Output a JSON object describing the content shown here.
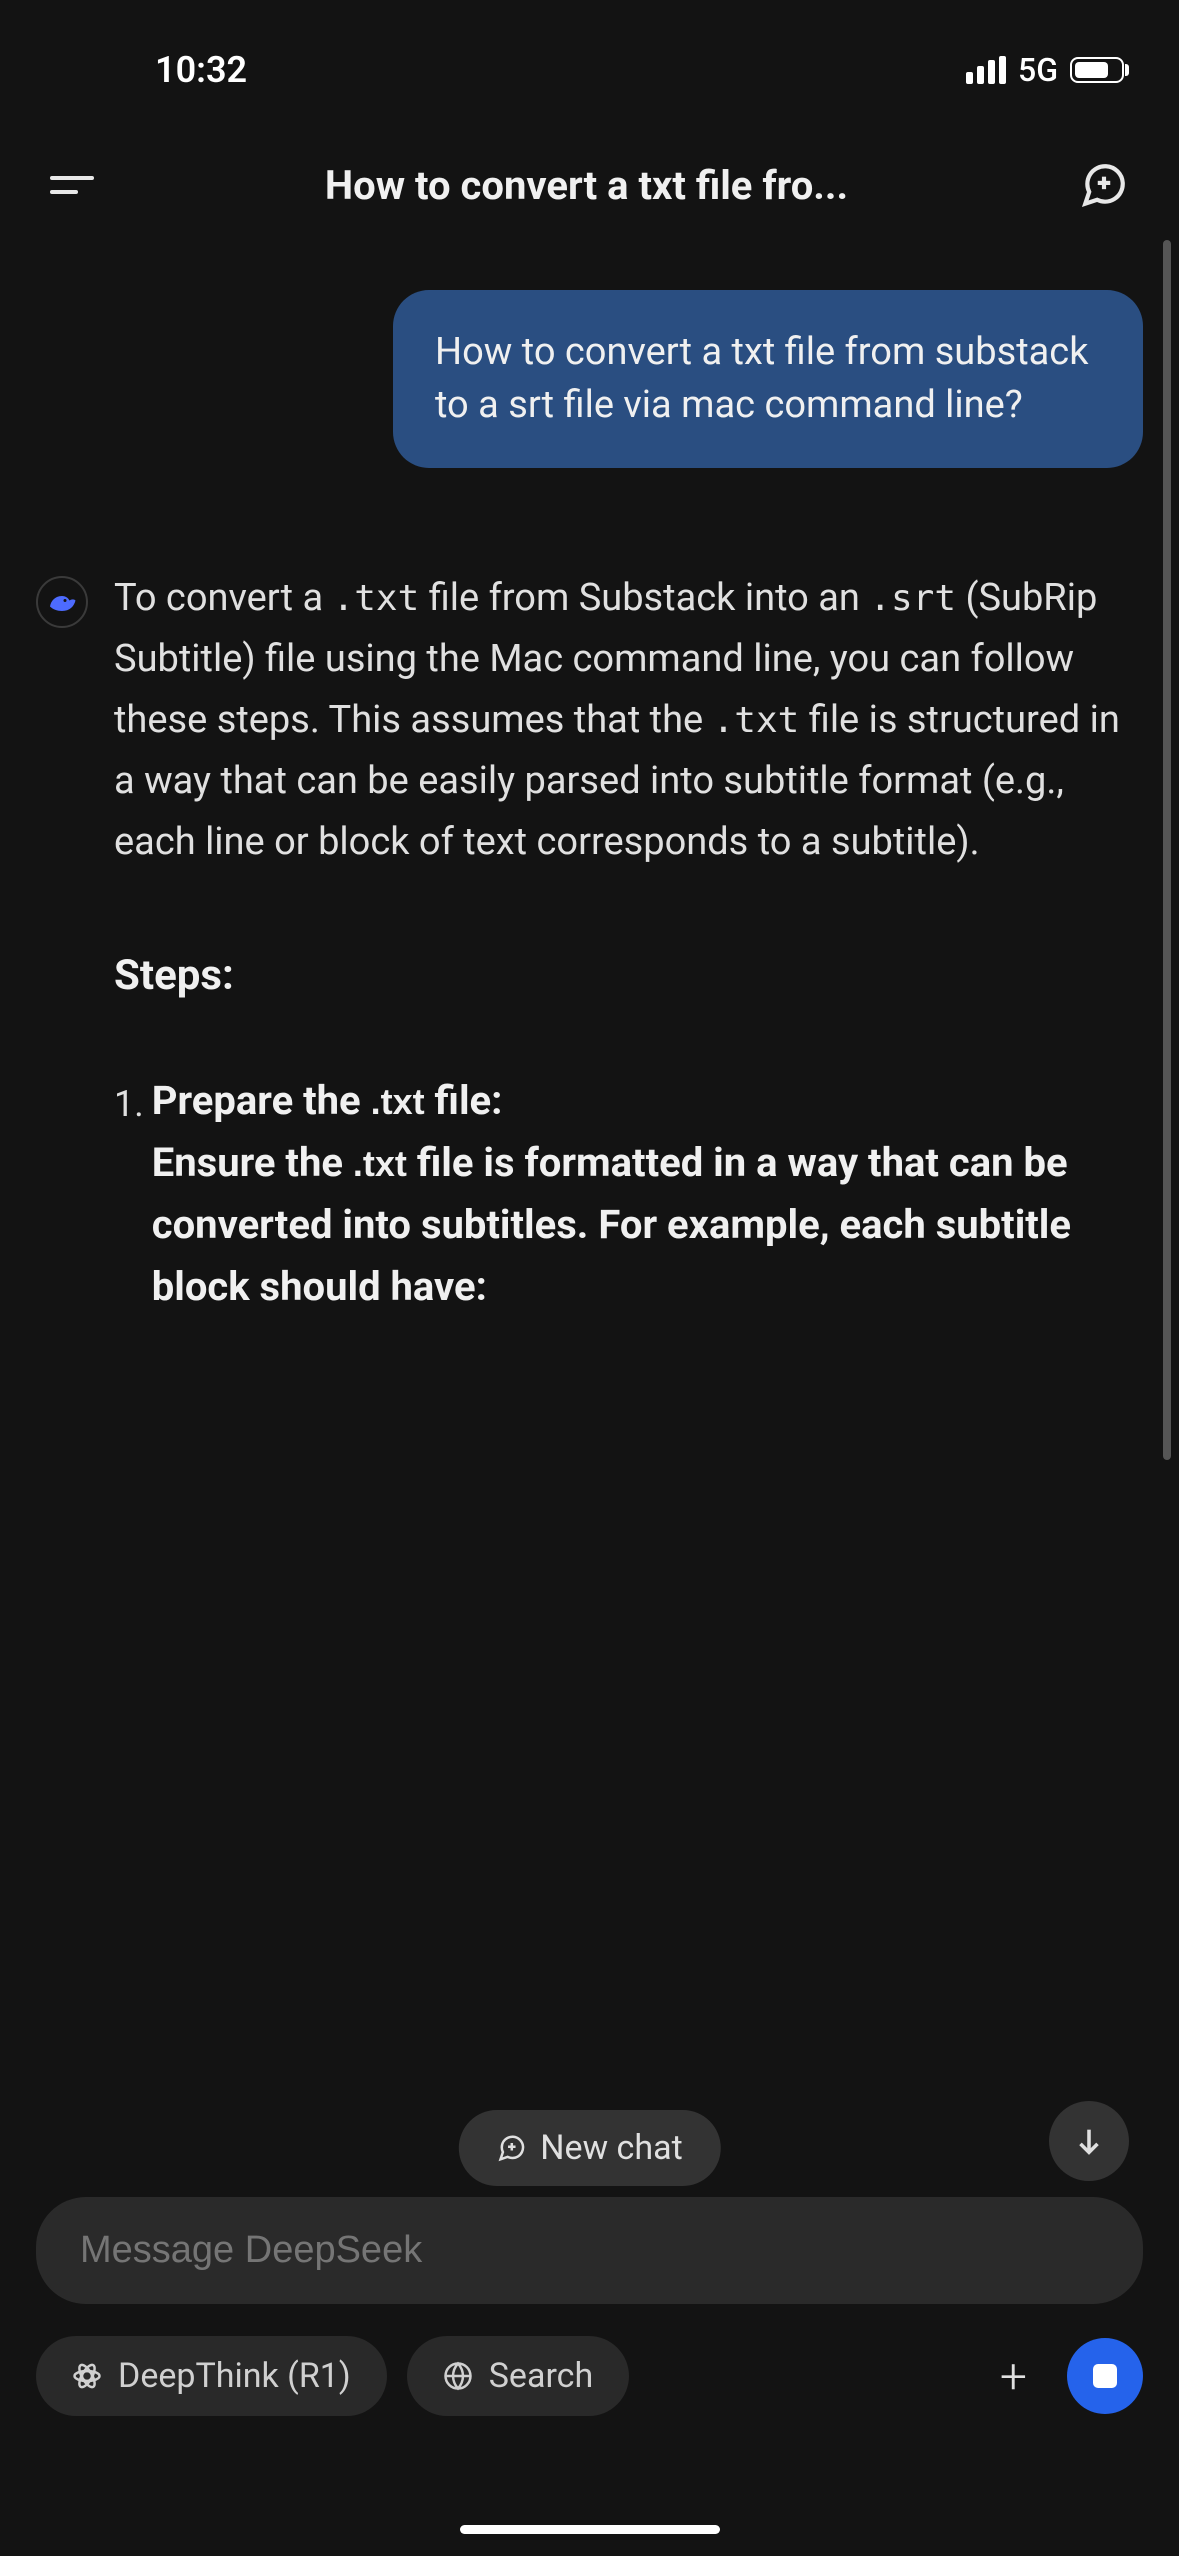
{
  "status": {
    "time": "10:32",
    "network": "5G"
  },
  "header": {
    "title": "How to convert a txt file fro..."
  },
  "user_message": "How to convert a txt file from substack to a srt file via mac command line?",
  "assistant": {
    "intro_part1": "To convert a ",
    "code1": ".txt",
    "intro_part2": " file from Substack into an ",
    "code2": ".srt",
    "intro_part3": " (SubRip Subtitle) file using the Mac command line, you can follow these steps. This assumes that the ",
    "code3": ".txt",
    "intro_part4": " file is structured in a way that can be easily parsed into subtitle format (e.g., each line or block of text corresponds to a subtitle).",
    "steps_heading": "Steps:",
    "step1_number": "1.",
    "step1_title_part1": "Prepare the ",
    "step1_code": ".txt",
    "step1_title_part2": " file:",
    "step1_body_part1": "Ensure the ",
    "step1_body_code": ".txt",
    "step1_body_part2": " file is formatted in a way that can be converted into subtitles. For example, each subtitle block should have:"
  },
  "floating": {
    "new_chat": "New chat"
  },
  "input": {
    "placeholder": "Message DeepSeek"
  },
  "buttons": {
    "deepthink": "DeepThink (R1)",
    "search": "Search"
  }
}
